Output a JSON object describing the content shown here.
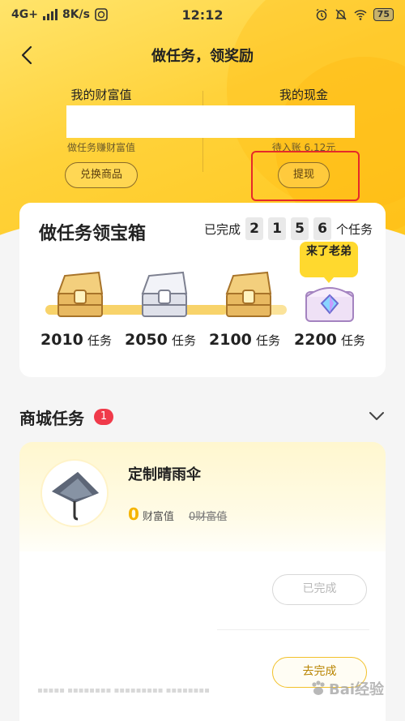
{
  "status_bar": {
    "network": "4G+",
    "speed": "8K/s",
    "time": "12:12",
    "battery": "75",
    "icons": [
      "signal-icon",
      "app-notification-icon",
      "alarm-icon",
      "mute-icon",
      "wifi-icon",
      "battery-icon"
    ]
  },
  "header": {
    "title": "做任务，领奖励",
    "back_icon": "chevron-left-icon"
  },
  "wealth": {
    "left_label": "我的财富值",
    "left_sub": "做任务赚财富值",
    "left_button": "兑换商品",
    "right_label": "我的现金",
    "right_sub": "待入账 6.12元",
    "right_button": "提现"
  },
  "treasure": {
    "title": "做任务领宝箱",
    "done_prefix": "已完成",
    "done_digits": [
      "2",
      "1",
      "5",
      "6"
    ],
    "done_suffix": "个任务",
    "progress_ratio": 0.75,
    "milestones": [
      {
        "num": "2010",
        "unit": "任务",
        "chest": "gold"
      },
      {
        "num": "2050",
        "unit": "任务",
        "chest": "silver"
      },
      {
        "num": "2100",
        "unit": "任务",
        "chest": "gold"
      },
      {
        "num": "2200",
        "unit": "任务",
        "chest": "diamond"
      }
    ],
    "tip": "来了老弟"
  },
  "shop": {
    "title": "商城任务",
    "badge": "1",
    "expand_icon": "chevron-down-icon",
    "item": {
      "name": "定制晴雨伞",
      "price": "0",
      "price_unit": "财富值",
      "old_price": "0财富值",
      "image_icon": "umbrella-icon"
    },
    "buttons": {
      "completed": "已完成",
      "go_complete": "去完成"
    },
    "faint_text": "▪▪▪▪▪ ▪▪▪▪▪▪▪▪ ▪▪▪▪▪▪▪▪▪ ▪▪▪▪▪▪▪▪"
  },
  "watermark": {
    "text": "Bai经验"
  },
  "colors": {
    "accent_yellow": "#ffd23a",
    "highlight_red": "#e52a2a",
    "badge_red": "#f03a4a",
    "price_yellow": "#f5b400"
  }
}
